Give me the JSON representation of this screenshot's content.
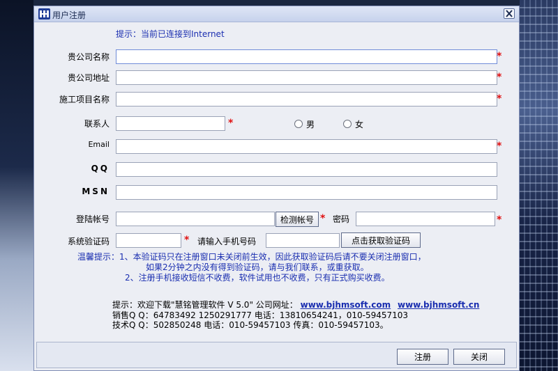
{
  "window": {
    "title": "用户注册",
    "hint": "提示：当前已连接到Internet"
  },
  "form": {
    "company_name_label": "贵公司名称",
    "company_address_label": "贵公司地址",
    "project_name_label": "施工项目名称",
    "contact_label": "联系人",
    "gender_male": "男",
    "gender_female": "女",
    "email_label": "Email",
    "qq_label": "QQ",
    "msn_label": "MSN",
    "login_account_label": "登陆帐号",
    "check_account_button": "检测帐号",
    "password_label": "密码",
    "system_code_label": "系统验证码",
    "phone_label": "请输入手机号码",
    "get_code_button": "点击获取验证码",
    "required_mark": "*"
  },
  "notes": {
    "line1": "温馨提示：1、本验证码只在注册窗口未关闭前生效，因此获取验证码后请不要关闭注册窗口，",
    "line2": "如果2分钟之内没有得到验证码，请与我们联系，或重获取。",
    "line3": "2、注册手机接收短信不收费，软件试用也不收费，只有正式购买收费。"
  },
  "info": {
    "download_prefix": "提示：欢迎下载\"慧铭管理软件 V 5.0\" 公司网址：",
    "site1": "www.bjhmsoft.com",
    "site2": "www.bjhmsoft.cn",
    "sales": "销售Q Q：64783492  1250291777 电话：13810654241，010-59457103",
    "tech": "技术Q Q：502850248 电话：010-59457103 传真：010-59457103。"
  },
  "footer": {
    "register_button": "注册",
    "close_button": "关闭"
  },
  "colors": {
    "hint_blue": "#1a2eb0",
    "required_red": "#e01010"
  }
}
